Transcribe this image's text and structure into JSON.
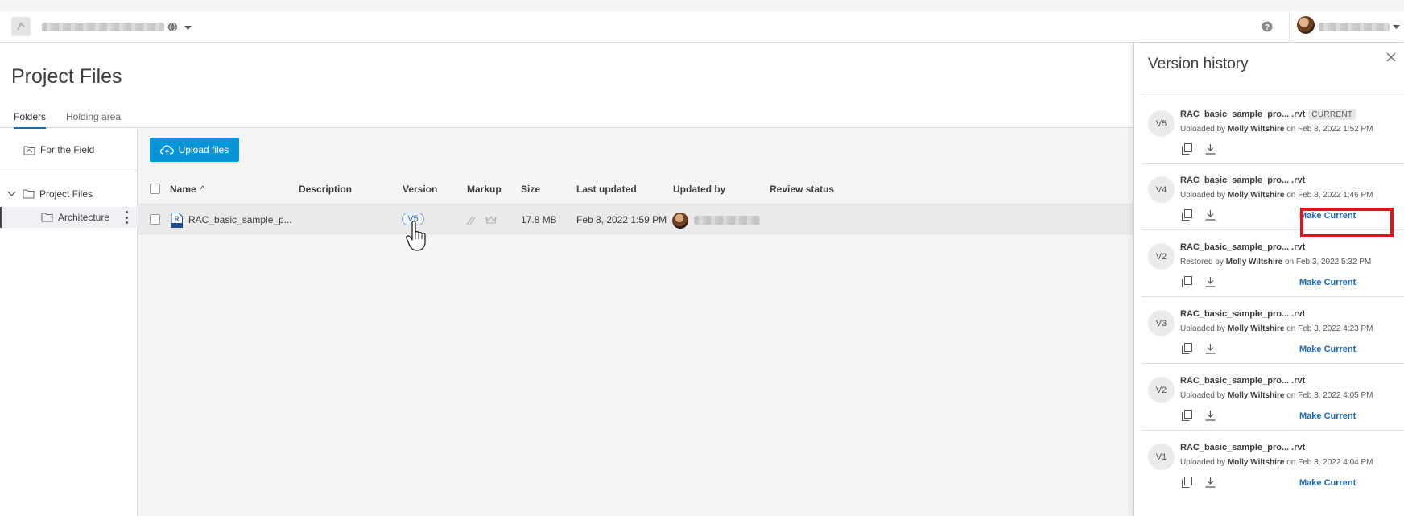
{
  "header": {
    "app_icon": "app-logo-icon",
    "project_selector_icon": "globe-icon",
    "help_icon": "help-icon"
  },
  "page": {
    "title": "Project Files"
  },
  "tabs": [
    {
      "label": "Folders",
      "active": true
    },
    {
      "label": "Holding area",
      "active": false
    }
  ],
  "sidebar": {
    "field_item": "For the Field",
    "tree": [
      {
        "label": "Project Files",
        "expanded": true
      },
      {
        "label": "Architecture",
        "selected": true
      }
    ]
  },
  "toolbar": {
    "upload_label": "Upload files"
  },
  "table": {
    "columns": [
      "Name",
      "Description",
      "Version",
      "Markup",
      "Size",
      "Last updated",
      "Updated by",
      "Review status"
    ],
    "sort_indicator": "^",
    "rows": [
      {
        "name": "RAC_basic_sample_p...",
        "description": "",
        "version": "V5",
        "size": "17.8 MB",
        "last_updated": "Feb 8, 2022 1:59 PM",
        "review_status": ""
      }
    ]
  },
  "version_panel": {
    "title": "Version history",
    "make_current_label": "Make Current",
    "current_badge": "CURRENT",
    "highlight_color": "#d9151f",
    "versions": [
      {
        "badge": "V5",
        "file": "RAC_basic_sample_pro... .rvt",
        "action": "Uploaded by",
        "user": "Molly Wiltshire",
        "date": "on Feb 8, 2022 1:52 PM",
        "is_current": true
      },
      {
        "badge": "V4",
        "file": "RAC_basic_sample_pro... .rvt",
        "action": "Uploaded by",
        "user": "Molly Wiltshire",
        "date": "on Feb 8, 2022 1:46 PM",
        "is_current": false
      },
      {
        "badge": "V2",
        "file": "RAC_basic_sample_pro... .rvt",
        "action": "Restored by",
        "user": "Molly Wiltshire",
        "date": "on Feb 3, 2022 5:32 PM",
        "is_current": false
      },
      {
        "badge": "V3",
        "file": "RAC_basic_sample_pro... .rvt",
        "action": "Uploaded by",
        "user": "Molly Wiltshire",
        "date": "on Feb 3, 2022 4:23 PM",
        "is_current": false
      },
      {
        "badge": "V2",
        "file": "RAC_basic_sample_pro... .rvt",
        "action": "Uploaded by",
        "user": "Molly Wiltshire",
        "date": "on Feb 3, 2022 4:05 PM",
        "is_current": false
      },
      {
        "badge": "V1",
        "file": "RAC_basic_sample_pro... .rvt",
        "action": "Uploaded by",
        "user": "Molly Wiltshire",
        "date": "on Feb 3, 2022 4:04 PM",
        "is_current": false
      }
    ]
  },
  "colors": {
    "accent": "#0696d7",
    "link": "#1e6ab0",
    "tab_underline": "#0b6ec5"
  }
}
